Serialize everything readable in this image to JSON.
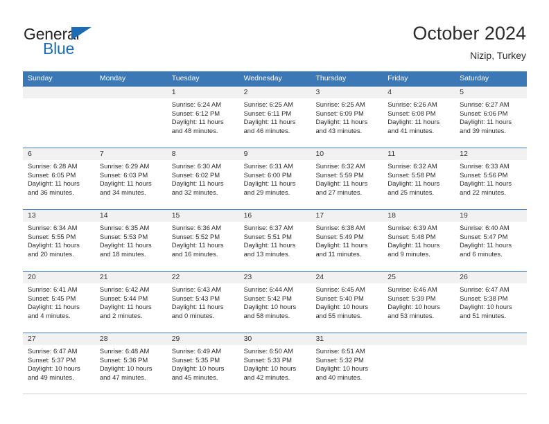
{
  "brand": {
    "line1": "General",
    "line2": "Blue",
    "colors": {
      "text": "#231f20",
      "accent": "#1b6cb5"
    }
  },
  "header": {
    "title": "October 2024",
    "location": "Nizip, Turkey"
  },
  "calendar": {
    "accent_color": "#3b78b5",
    "date_strip_color": "#f1f1f1",
    "weekdays": [
      "Sunday",
      "Monday",
      "Tuesday",
      "Wednesday",
      "Thursday",
      "Friday",
      "Saturday"
    ],
    "labels": {
      "sunrise": "Sunrise:",
      "sunset": "Sunset:",
      "daylight": "Daylight:"
    },
    "weeks": [
      [
        {
          "date": "",
          "empty": true
        },
        {
          "date": "",
          "empty": true
        },
        {
          "date": "1",
          "sunrise": "Sunrise: 6:24 AM",
          "sunset": "Sunset: 6:12 PM",
          "daylight": "Daylight: 11 hours and 48 minutes."
        },
        {
          "date": "2",
          "sunrise": "Sunrise: 6:25 AM",
          "sunset": "Sunset: 6:11 PM",
          "daylight": "Daylight: 11 hours and 46 minutes."
        },
        {
          "date": "3",
          "sunrise": "Sunrise: 6:25 AM",
          "sunset": "Sunset: 6:09 PM",
          "daylight": "Daylight: 11 hours and 43 minutes."
        },
        {
          "date": "4",
          "sunrise": "Sunrise: 6:26 AM",
          "sunset": "Sunset: 6:08 PM",
          "daylight": "Daylight: 11 hours and 41 minutes."
        },
        {
          "date": "5",
          "sunrise": "Sunrise: 6:27 AM",
          "sunset": "Sunset: 6:06 PM",
          "daylight": "Daylight: 11 hours and 39 minutes."
        }
      ],
      [
        {
          "date": "6",
          "sunrise": "Sunrise: 6:28 AM",
          "sunset": "Sunset: 6:05 PM",
          "daylight": "Daylight: 11 hours and 36 minutes."
        },
        {
          "date": "7",
          "sunrise": "Sunrise: 6:29 AM",
          "sunset": "Sunset: 6:03 PM",
          "daylight": "Daylight: 11 hours and 34 minutes."
        },
        {
          "date": "8",
          "sunrise": "Sunrise: 6:30 AM",
          "sunset": "Sunset: 6:02 PM",
          "daylight": "Daylight: 11 hours and 32 minutes."
        },
        {
          "date": "9",
          "sunrise": "Sunrise: 6:31 AM",
          "sunset": "Sunset: 6:00 PM",
          "daylight": "Daylight: 11 hours and 29 minutes."
        },
        {
          "date": "10",
          "sunrise": "Sunrise: 6:32 AM",
          "sunset": "Sunset: 5:59 PM",
          "daylight": "Daylight: 11 hours and 27 minutes."
        },
        {
          "date": "11",
          "sunrise": "Sunrise: 6:32 AM",
          "sunset": "Sunset: 5:58 PM",
          "daylight": "Daylight: 11 hours and 25 minutes."
        },
        {
          "date": "12",
          "sunrise": "Sunrise: 6:33 AM",
          "sunset": "Sunset: 5:56 PM",
          "daylight": "Daylight: 11 hours and 22 minutes."
        }
      ],
      [
        {
          "date": "13",
          "sunrise": "Sunrise: 6:34 AM",
          "sunset": "Sunset: 5:55 PM",
          "daylight": "Daylight: 11 hours and 20 minutes."
        },
        {
          "date": "14",
          "sunrise": "Sunrise: 6:35 AM",
          "sunset": "Sunset: 5:53 PM",
          "daylight": "Daylight: 11 hours and 18 minutes."
        },
        {
          "date": "15",
          "sunrise": "Sunrise: 6:36 AM",
          "sunset": "Sunset: 5:52 PM",
          "daylight": "Daylight: 11 hours and 16 minutes."
        },
        {
          "date": "16",
          "sunrise": "Sunrise: 6:37 AM",
          "sunset": "Sunset: 5:51 PM",
          "daylight": "Daylight: 11 hours and 13 minutes."
        },
        {
          "date": "17",
          "sunrise": "Sunrise: 6:38 AM",
          "sunset": "Sunset: 5:49 PM",
          "daylight": "Daylight: 11 hours and 11 minutes."
        },
        {
          "date": "18",
          "sunrise": "Sunrise: 6:39 AM",
          "sunset": "Sunset: 5:48 PM",
          "daylight": "Daylight: 11 hours and 9 minutes."
        },
        {
          "date": "19",
          "sunrise": "Sunrise: 6:40 AM",
          "sunset": "Sunset: 5:47 PM",
          "daylight": "Daylight: 11 hours and 6 minutes."
        }
      ],
      [
        {
          "date": "20",
          "sunrise": "Sunrise: 6:41 AM",
          "sunset": "Sunset: 5:45 PM",
          "daylight": "Daylight: 11 hours and 4 minutes."
        },
        {
          "date": "21",
          "sunrise": "Sunrise: 6:42 AM",
          "sunset": "Sunset: 5:44 PM",
          "daylight": "Daylight: 11 hours and 2 minutes."
        },
        {
          "date": "22",
          "sunrise": "Sunrise: 6:43 AM",
          "sunset": "Sunset: 5:43 PM",
          "daylight": "Daylight: 11 hours and 0 minutes."
        },
        {
          "date": "23",
          "sunrise": "Sunrise: 6:44 AM",
          "sunset": "Sunset: 5:42 PM",
          "daylight": "Daylight: 10 hours and 58 minutes."
        },
        {
          "date": "24",
          "sunrise": "Sunrise: 6:45 AM",
          "sunset": "Sunset: 5:40 PM",
          "daylight": "Daylight: 10 hours and 55 minutes."
        },
        {
          "date": "25",
          "sunrise": "Sunrise: 6:46 AM",
          "sunset": "Sunset: 5:39 PM",
          "daylight": "Daylight: 10 hours and 53 minutes."
        },
        {
          "date": "26",
          "sunrise": "Sunrise: 6:47 AM",
          "sunset": "Sunset: 5:38 PM",
          "daylight": "Daylight: 10 hours and 51 minutes."
        }
      ],
      [
        {
          "date": "27",
          "sunrise": "Sunrise: 6:47 AM",
          "sunset": "Sunset: 5:37 PM",
          "daylight": "Daylight: 10 hours and 49 minutes."
        },
        {
          "date": "28",
          "sunrise": "Sunrise: 6:48 AM",
          "sunset": "Sunset: 5:36 PM",
          "daylight": "Daylight: 10 hours and 47 minutes."
        },
        {
          "date": "29",
          "sunrise": "Sunrise: 6:49 AM",
          "sunset": "Sunset: 5:35 PM",
          "daylight": "Daylight: 10 hours and 45 minutes."
        },
        {
          "date": "30",
          "sunrise": "Sunrise: 6:50 AM",
          "sunset": "Sunset: 5:33 PM",
          "daylight": "Daylight: 10 hours and 42 minutes."
        },
        {
          "date": "31",
          "sunrise": "Sunrise: 6:51 AM",
          "sunset": "Sunset: 5:32 PM",
          "daylight": "Daylight: 10 hours and 40 minutes."
        },
        {
          "date": "",
          "empty": true
        },
        {
          "date": "",
          "empty": true
        }
      ]
    ]
  }
}
